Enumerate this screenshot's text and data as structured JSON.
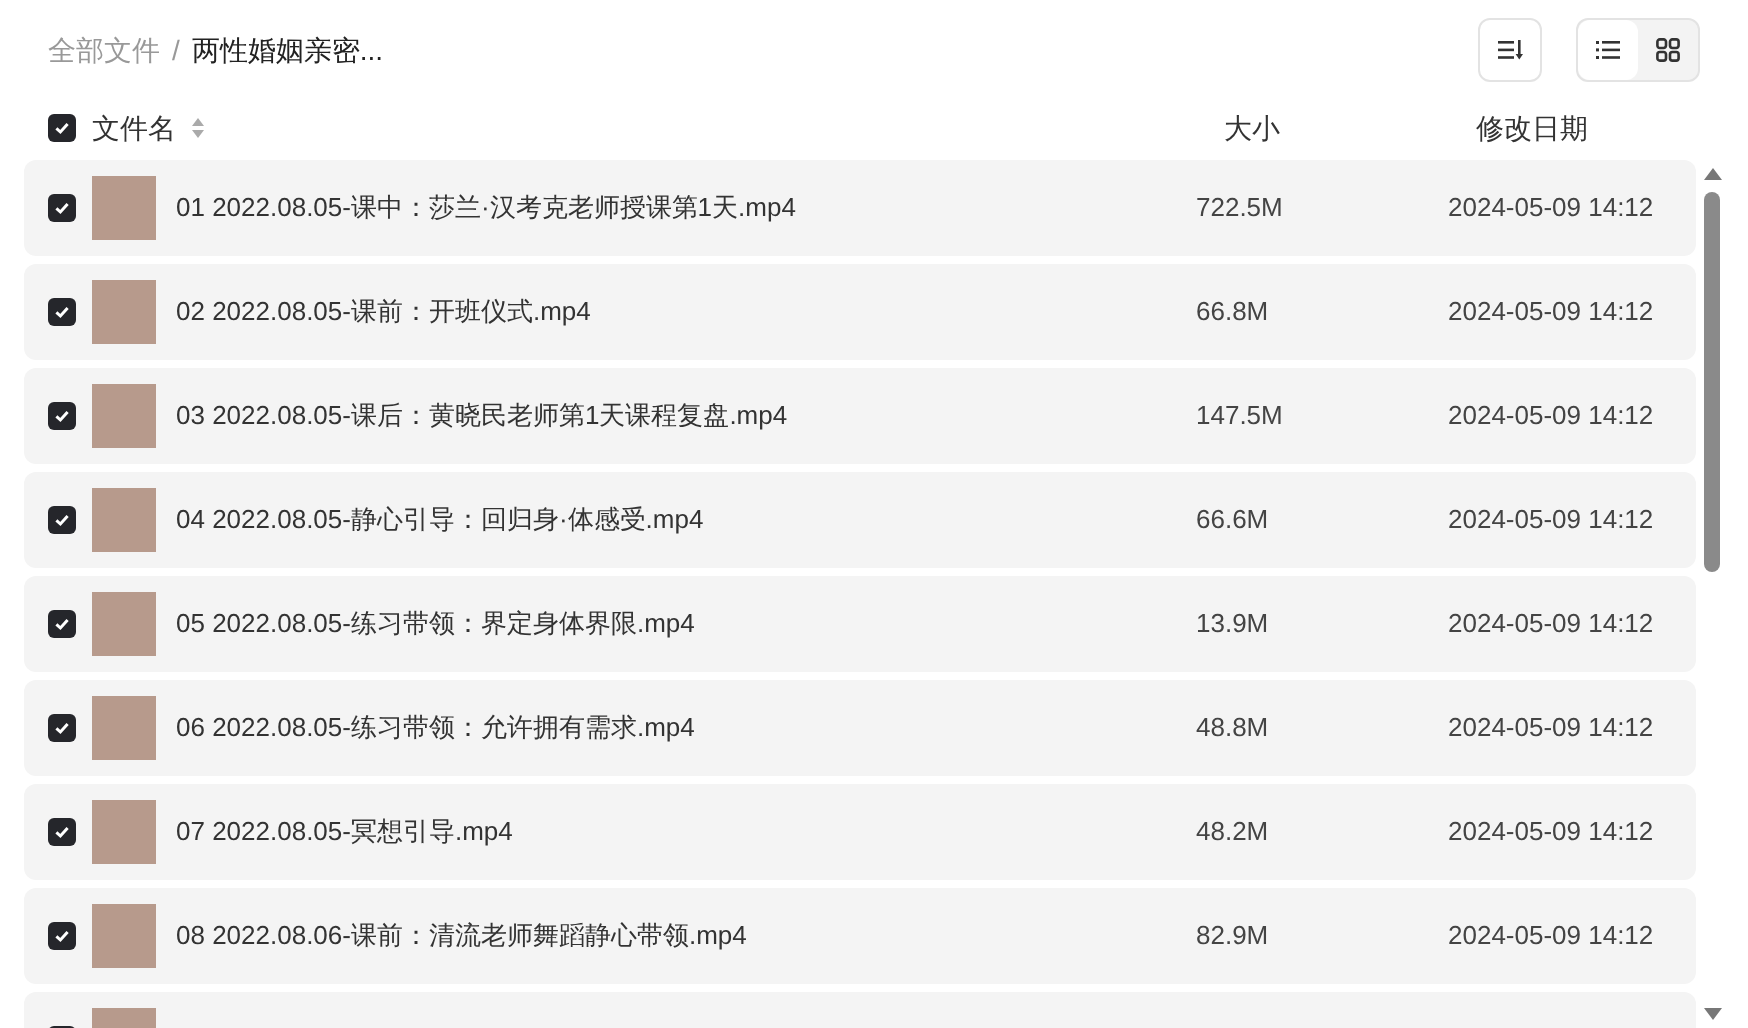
{
  "breadcrumb": [
    {
      "label": "全部文件",
      "current": false
    },
    {
      "label": "/",
      "current": false
    },
    {
      "label": "两性婚姻亲密...",
      "current": true
    }
  ],
  "view_modes": [
    {
      "kind": "list",
      "selected": true
    },
    {
      "kind": "grid",
      "selected": false
    }
  ],
  "header": {
    "checked": true,
    "name": "文件名",
    "size": "大小",
    "date": "修改日期"
  },
  "rows": [
    {
      "checked": true,
      "name": "01 2022.08.05-课中：莎兰·汉考克老师授课第1天.mp4",
      "size": "722.5M",
      "date": "2024-05-09 14:12"
    },
    {
      "checked": true,
      "name": "02 2022.08.05-课前：开班仪式.mp4",
      "size": "66.8M",
      "date": "2024-05-09 14:12"
    },
    {
      "checked": true,
      "name": "03 2022.08.05-课后：黄晓民老师第1天课程复盘.mp4",
      "size": "147.5M",
      "date": "2024-05-09 14:12"
    },
    {
      "checked": true,
      "name": "04 2022.08.05-静心引导：回归身·体感受.mp4",
      "size": "66.6M",
      "date": "2024-05-09 14:12"
    },
    {
      "checked": true,
      "name": "05 2022.08.05-练习带领：界定身体界限.mp4",
      "size": "13.9M",
      "date": "2024-05-09 14:12"
    },
    {
      "checked": true,
      "name": "06 2022.08.05-练习带领：允许拥有需求.mp4",
      "size": "48.8M",
      "date": "2024-05-09 14:12"
    },
    {
      "checked": true,
      "name": "07 2022.08.05-冥想引导.mp4",
      "size": "48.2M",
      "date": "2024-05-09 14:12"
    },
    {
      "checked": true,
      "name": "08 2022.08.06-课前：清流老师舞蹈静心带领.mp4",
      "size": "82.9M",
      "date": "2024-05-09 14:12"
    },
    {
      "checked": true
    }
  ]
}
